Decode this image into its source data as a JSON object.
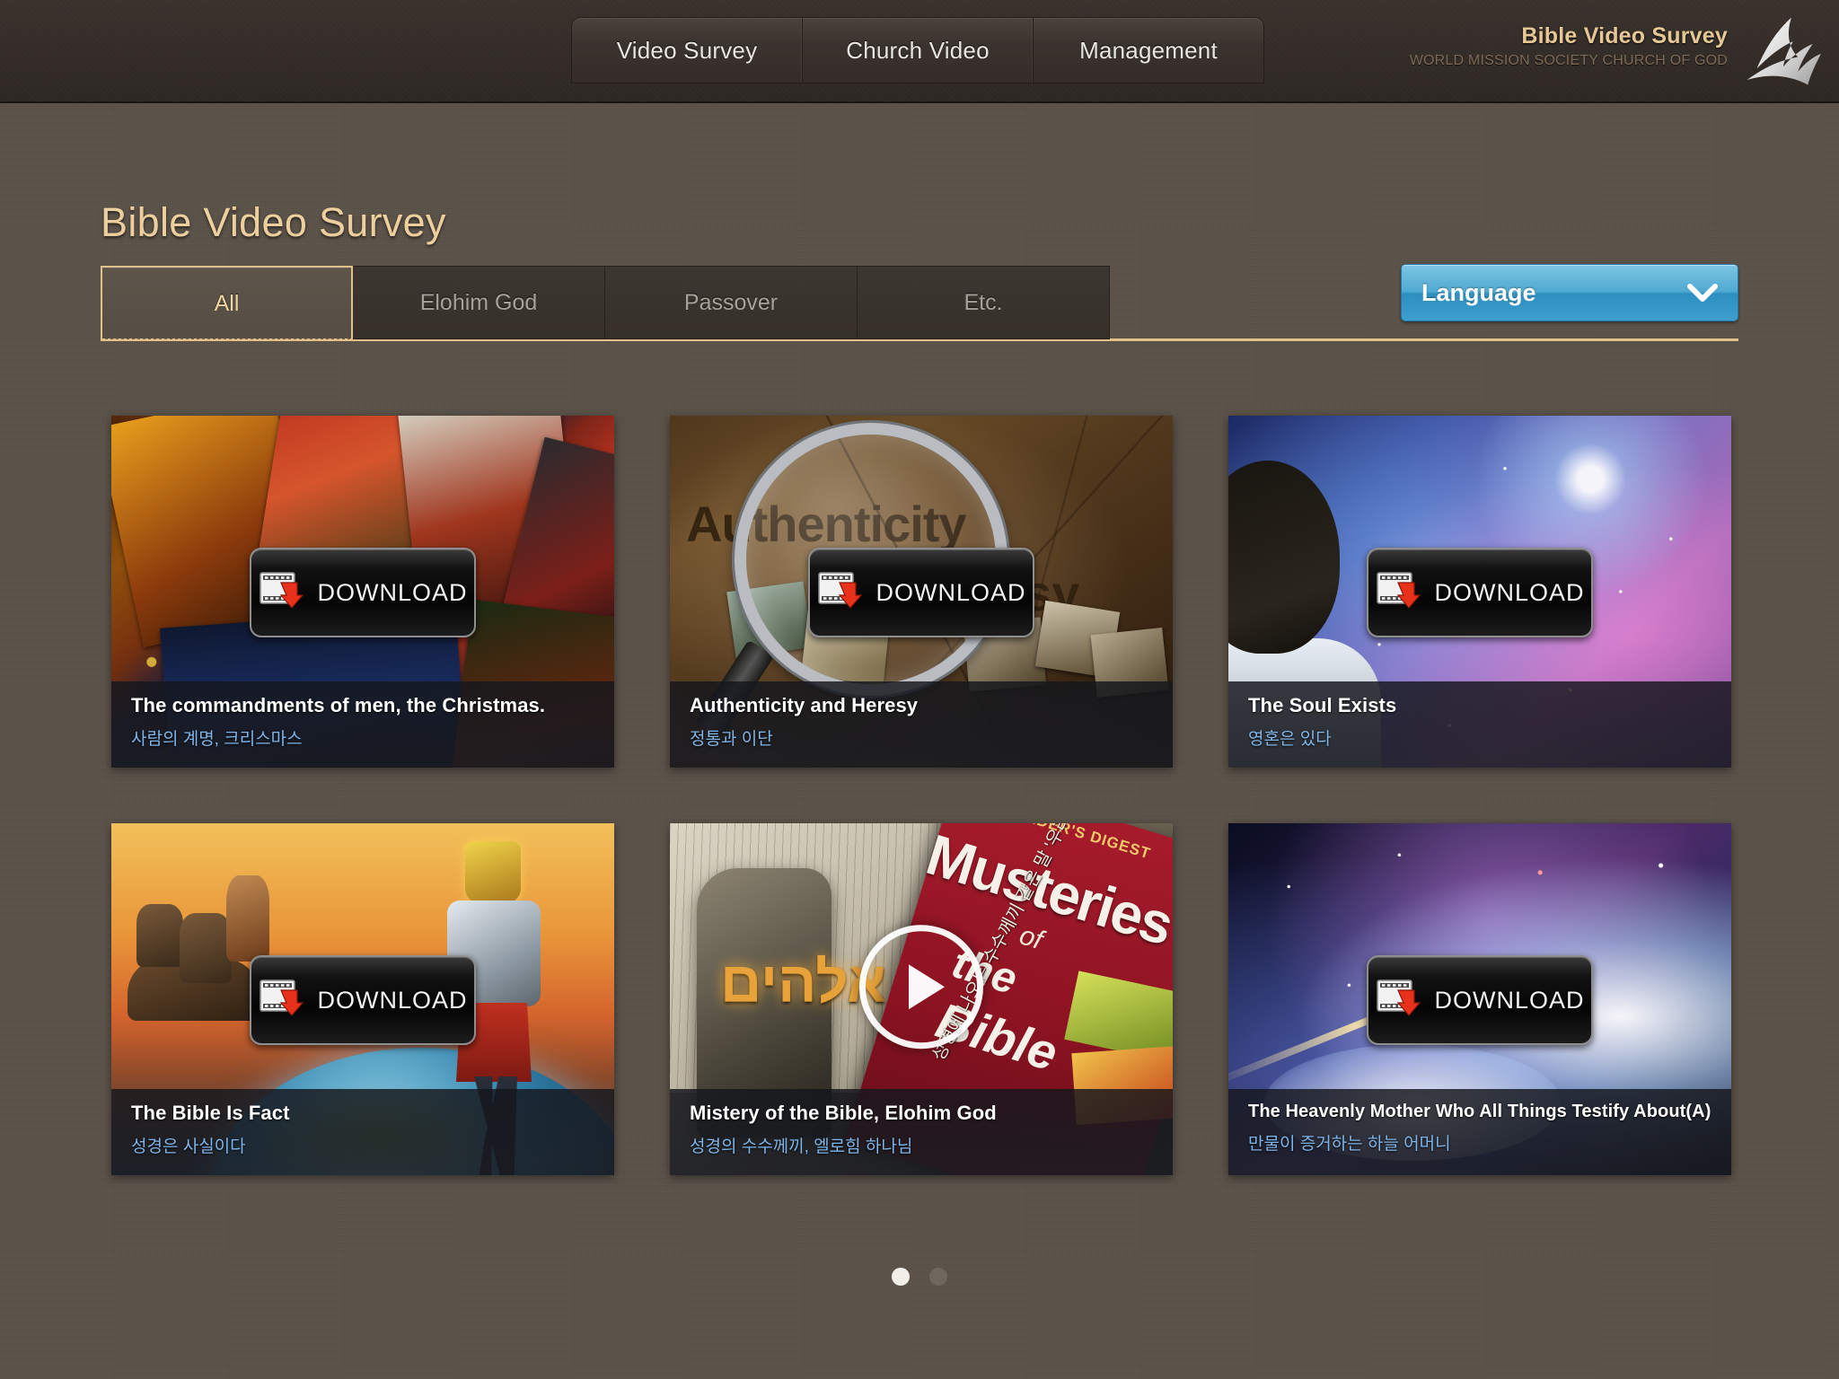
{
  "header": {
    "nav": [
      {
        "label": "Video Survey"
      },
      {
        "label": "Church Video"
      },
      {
        "label": "Management"
      }
    ],
    "brand": {
      "title": "Bible Video Survey",
      "subtitle": "WORLD MISSION SOCIETY CHURCH OF GOD",
      "logo_icon": "church-of-god-logo-icon"
    }
  },
  "page": {
    "title": "Bible Video Survey"
  },
  "categories": [
    {
      "label": "All",
      "active": true
    },
    {
      "label": "Elohim God",
      "active": false
    },
    {
      "label": "Passover",
      "active": false
    },
    {
      "label": "Etc.",
      "active": false
    }
  ],
  "language": {
    "label": "Language",
    "chevron_icon": "chevron-down-icon",
    "accent_color": "#3e9fcd"
  },
  "cards": [
    {
      "title": "The commandments of men, the Christmas.",
      "subtitle": "사람의 계명, 크리스마스",
      "action": "download",
      "action_label": "DOWNLOAD",
      "action_icon": "film-download-icon"
    },
    {
      "title": "Authenticity and Heresy",
      "subtitle": "정통과 이단",
      "action": "download",
      "action_label": "DOWNLOAD",
      "action_icon": "film-download-icon",
      "art_text": {
        "word1": "Authenticity",
        "word2": "eresy"
      }
    },
    {
      "title": "The Soul Exists",
      "subtitle": "영혼은 있다",
      "action": "download",
      "action_label": "DOWNLOAD",
      "action_icon": "film-download-icon"
    },
    {
      "title": "The Bible Is Fact",
      "subtitle": "성경은 사실이다",
      "action": "download",
      "action_label": "DOWNLOAD",
      "action_icon": "film-download-icon"
    },
    {
      "title": "Mistery of the Bible, Elohim God",
      "subtitle": "성경의 수수께끼, 엘로힘 하나님",
      "action": "play",
      "action_icon": "play-circle-icon",
      "art_text": {
        "magazine_brand": "READER'S DIGEST",
        "magazine_title": "Musteries",
        "magazine_of": "of",
        "magazine_the": "the",
        "magazine_bible": "Bible",
        "hebrew": "אלהים",
        "korean_overlay": "성경에 나오는 수수께끼 같은 말 '우리'"
      }
    },
    {
      "title": "The Heavenly Mother Who All Things Testify About(A)",
      "subtitle": "만물이 증거하는 하늘 어머니",
      "action": "download",
      "action_label": "DOWNLOAD",
      "action_icon": "film-download-icon"
    }
  ],
  "pagination": {
    "pages": [
      {
        "active": true
      },
      {
        "active": false
      }
    ]
  },
  "theme": {
    "background": "#5a5248",
    "header_bg": "#342d28",
    "accent_gold": "#e2c08a",
    "subtitle_blue": "#7fb5e8"
  }
}
